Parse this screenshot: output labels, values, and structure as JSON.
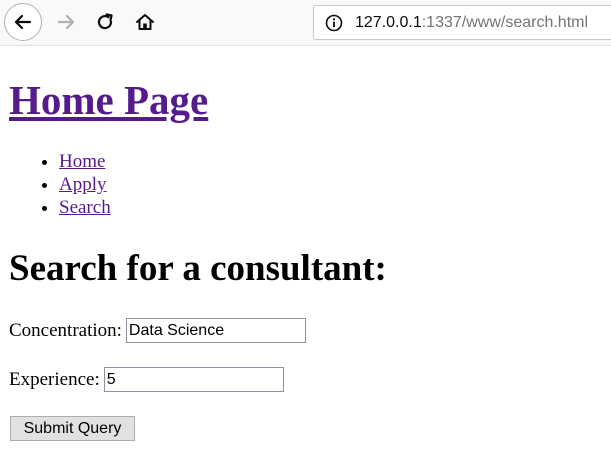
{
  "browser": {
    "url_host": "127.0.0.1",
    "url_path": ":1337/www/search.html",
    "icons": {
      "back": "back-arrow-icon",
      "forward": "forward-arrow-icon",
      "reload": "reload-icon",
      "home": "home-icon",
      "info": "info-icon"
    }
  },
  "page": {
    "title": "Home Page",
    "nav": {
      "items": [
        {
          "label": "Home"
        },
        {
          "label": "Apply"
        },
        {
          "label": "Search"
        }
      ]
    },
    "heading": "Search for a consultant:",
    "form": {
      "concentration_label": "Concentration:",
      "concentration_value": "Data Science",
      "experience_label": "Experience:",
      "experience_value": "5",
      "submit_label": "Submit Query"
    }
  },
  "colors": {
    "visited_link": "#551a8b",
    "toolbar_bg": "#f9f9fa"
  }
}
